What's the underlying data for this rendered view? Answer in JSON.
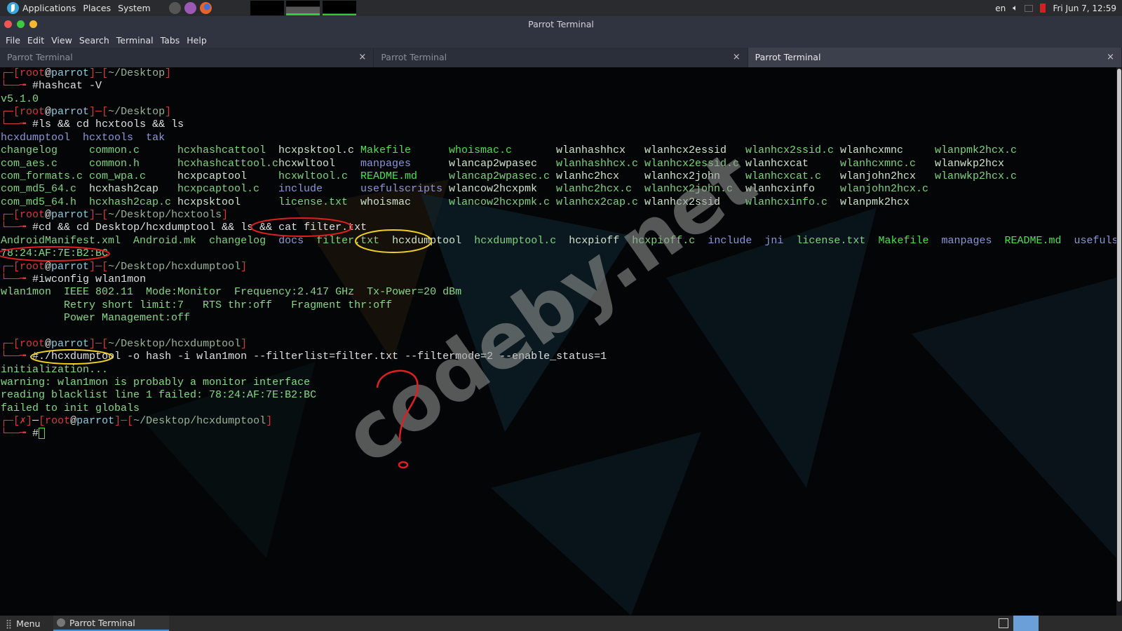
{
  "top_panel": {
    "menus": [
      "Applications",
      "Places",
      "System"
    ],
    "lang": "en",
    "clock": "Fri Jun 7, 12:59",
    "battery_color": "#d42020"
  },
  "window": {
    "title": "Parrot Terminal",
    "menu": [
      "File",
      "Edit",
      "View",
      "Search",
      "Terminal",
      "Tabs",
      "Help"
    ],
    "tabs": [
      {
        "label": "Parrot Terminal",
        "active": false
      },
      {
        "label": "Parrot Terminal",
        "active": false
      },
      {
        "label": "Parrot Terminal",
        "active": true
      }
    ],
    "tab_close": "×"
  },
  "prompt_chars": {
    "top": "┌─[",
    "mid": "]─[",
    "end": "]",
    "bottom": "└──╼ ",
    "at": "@",
    "err_open": "┌─[",
    "err_mark": "✗",
    "err_close": "]─["
  },
  "terminal": [
    {
      "t": "prompt",
      "user": "root",
      "host": "parrot",
      "path": "~/Desktop"
    },
    {
      "t": "cmd",
      "text": "#hashcat -V"
    },
    {
      "t": "out",
      "text": "v5.1.0"
    },
    {
      "t": "prompt",
      "user": "root",
      "host": "parrot",
      "path": "~/Desktop"
    },
    {
      "t": "cmd",
      "text": "#ls && cd hcxtools && ls"
    },
    {
      "t": "items",
      "items": [
        [
          "hcxdumptool",
          "dir"
        ],
        [
          "hcxtools",
          "dir"
        ],
        [
          "tak",
          "dir"
        ]
      ]
    },
    {
      "t": "grid",
      "cells": [
        [
          "changelog",
          "file"
        ],
        [
          "common.c",
          "file"
        ],
        [
          "hcxhashcattool",
          "file"
        ],
        [
          "hcxpsktool.c",
          "exec"
        ],
        [
          "Makefile",
          "bright"
        ],
        [
          "whoismac.c",
          "bright"
        ],
        [
          "wlanhashhcx",
          "exec"
        ],
        [
          "wlanhcx2essid",
          "exec"
        ],
        [
          "wlanhcx2ssid.c",
          "file"
        ],
        [
          "wlanhcxmnc",
          "exec"
        ],
        [
          "wlanpmk2hcx.c",
          "file"
        ]
      ]
    },
    {
      "t": "grid",
      "cells": [
        [
          "com_aes.c",
          "file"
        ],
        [
          "common.h",
          "file"
        ],
        [
          "hcxhashcattool.c",
          "file"
        ],
        [
          "hcxwltool",
          "exec"
        ],
        [
          "manpages",
          "dir"
        ],
        [
          "wlancap2wpasec",
          "exec"
        ],
        [
          "wlanhashhcx.c",
          "file"
        ],
        [
          "wlanhcx2essid.c",
          "file"
        ],
        [
          "wlanhcxcat",
          "exec"
        ],
        [
          "wlanhcxmnc.c",
          "file"
        ],
        [
          "wlanwkp2hcx",
          "exec"
        ]
      ]
    },
    {
      "t": "grid",
      "cells": [
        [
          "com_formats.c",
          "file"
        ],
        [
          "com_wpa.c",
          "file"
        ],
        [
          "hcxpcaptool",
          "exec"
        ],
        [
          "hcxwltool.c",
          "file"
        ],
        [
          "README.md",
          "bright"
        ],
        [
          "wlancap2wpasec.c",
          "file"
        ],
        [
          "wlanhc2hcx",
          "exec"
        ],
        [
          "wlanhcx2john",
          "exec"
        ],
        [
          "wlanhcxcat.c",
          "file"
        ],
        [
          "wlanjohn2hcx",
          "exec"
        ],
        [
          "wlanwkp2hcx.c",
          "file"
        ]
      ]
    },
    {
      "t": "grid",
      "cells": [
        [
          "com_md5_64.c",
          "file"
        ],
        [
          "hcxhash2cap",
          "exec"
        ],
        [
          "hcxpcaptool.c",
          "file"
        ],
        [
          "include",
          "dir"
        ],
        [
          "usefulscripts",
          "dir"
        ],
        [
          "wlancow2hcxpmk",
          "exec"
        ],
        [
          "wlanhc2hcx.c",
          "file"
        ],
        [
          "wlanhcx2john.c",
          "file"
        ],
        [
          "wlanhcxinfo",
          "exec"
        ],
        [
          "wlanjohn2hcx.c",
          "file"
        ]
      ]
    },
    {
      "t": "grid",
      "cells": [
        [
          "com_md5_64.h",
          "file"
        ],
        [
          "hcxhash2cap.c",
          "file"
        ],
        [
          "hcxpsktool",
          "exec"
        ],
        [
          "license.txt",
          "file"
        ],
        [
          "whoismac",
          "exec"
        ],
        [
          "wlancow2hcxpmk.c",
          "file"
        ],
        [
          "wlanhcx2cap.c",
          "file"
        ],
        [
          "wlanhcx2ssid",
          "exec"
        ],
        [
          "wlanhcxinfo.c",
          "file"
        ],
        [
          "wlanpmk2hcx",
          "exec"
        ]
      ]
    },
    {
      "t": "prompt",
      "user": "root",
      "host": "parrot",
      "path": "~/Desktop/hcxtools"
    },
    {
      "t": "cmd",
      "text": "#cd && cd Desktop/hcxdumptool && ls && cat filter.txt"
    },
    {
      "t": "items",
      "items": [
        [
          "AndroidManifest.xml",
          "file"
        ],
        [
          "Android.mk",
          "file"
        ],
        [
          "changelog",
          "file"
        ],
        [
          "docs",
          "dir"
        ],
        [
          "filter.txt",
          "file"
        ],
        [
          "hcxdumptool",
          "exec"
        ],
        [
          "hcxdumptool.c",
          "file"
        ],
        [
          "hcxpioff",
          "exec"
        ],
        [
          "hcxpioff.c",
          "file"
        ],
        [
          "include",
          "dir"
        ],
        [
          "jni",
          "dir"
        ],
        [
          "license.txt",
          "file"
        ],
        [
          "Makefile",
          "bright"
        ],
        [
          "manpages",
          "dir"
        ],
        [
          "README.md",
          "bright"
        ],
        [
          "usefulscripts",
          "dir"
        ]
      ]
    },
    {
      "t": "out",
      "text": "78:24:AF:7E:B2:BC"
    },
    {
      "t": "prompt",
      "user": "root",
      "host": "parrot",
      "path": "~/Desktop/hcxdumptool"
    },
    {
      "t": "cmd",
      "text": "#iwconfig wlan1mon"
    },
    {
      "t": "out",
      "text": "wlan1mon  IEEE 802.11  Mode:Monitor  Frequency:2.417 GHz  Tx-Power=20 dBm"
    },
    {
      "t": "out",
      "text": "          Retry short limit:7   RTS thr:off   Fragment thr:off"
    },
    {
      "t": "out",
      "text": "          Power Management:off"
    },
    {
      "t": "out",
      "text": ""
    },
    {
      "t": "prompt",
      "user": "root",
      "host": "parrot",
      "path": "~/Desktop/hcxdumptool"
    },
    {
      "t": "cmd",
      "text": "#./hcxdumptool -o hash -i wlan1mon --filterlist=filter.txt --filtermode=2 --enable_status=1"
    },
    {
      "t": "out",
      "text": "initialization..."
    },
    {
      "t": "out",
      "text": "warning: wlan1mon is probably a monitor interface"
    },
    {
      "t": "out",
      "text": "reading blacklist line 1 failed: 78:24:AF:7E:B2:BC"
    },
    {
      "t": "out",
      "text": "failed to init globals"
    },
    {
      "t": "prompt",
      "user": "root",
      "host": "parrot",
      "path": "~/Desktop/hcxdumptool",
      "err": true
    },
    {
      "t": "cmd",
      "text": "#",
      "cursor": true
    }
  ],
  "watermark": "codeby.net",
  "annotation_mark": "?",
  "taskbar": {
    "menu": "Menu",
    "task": "Parrot Terminal"
  }
}
